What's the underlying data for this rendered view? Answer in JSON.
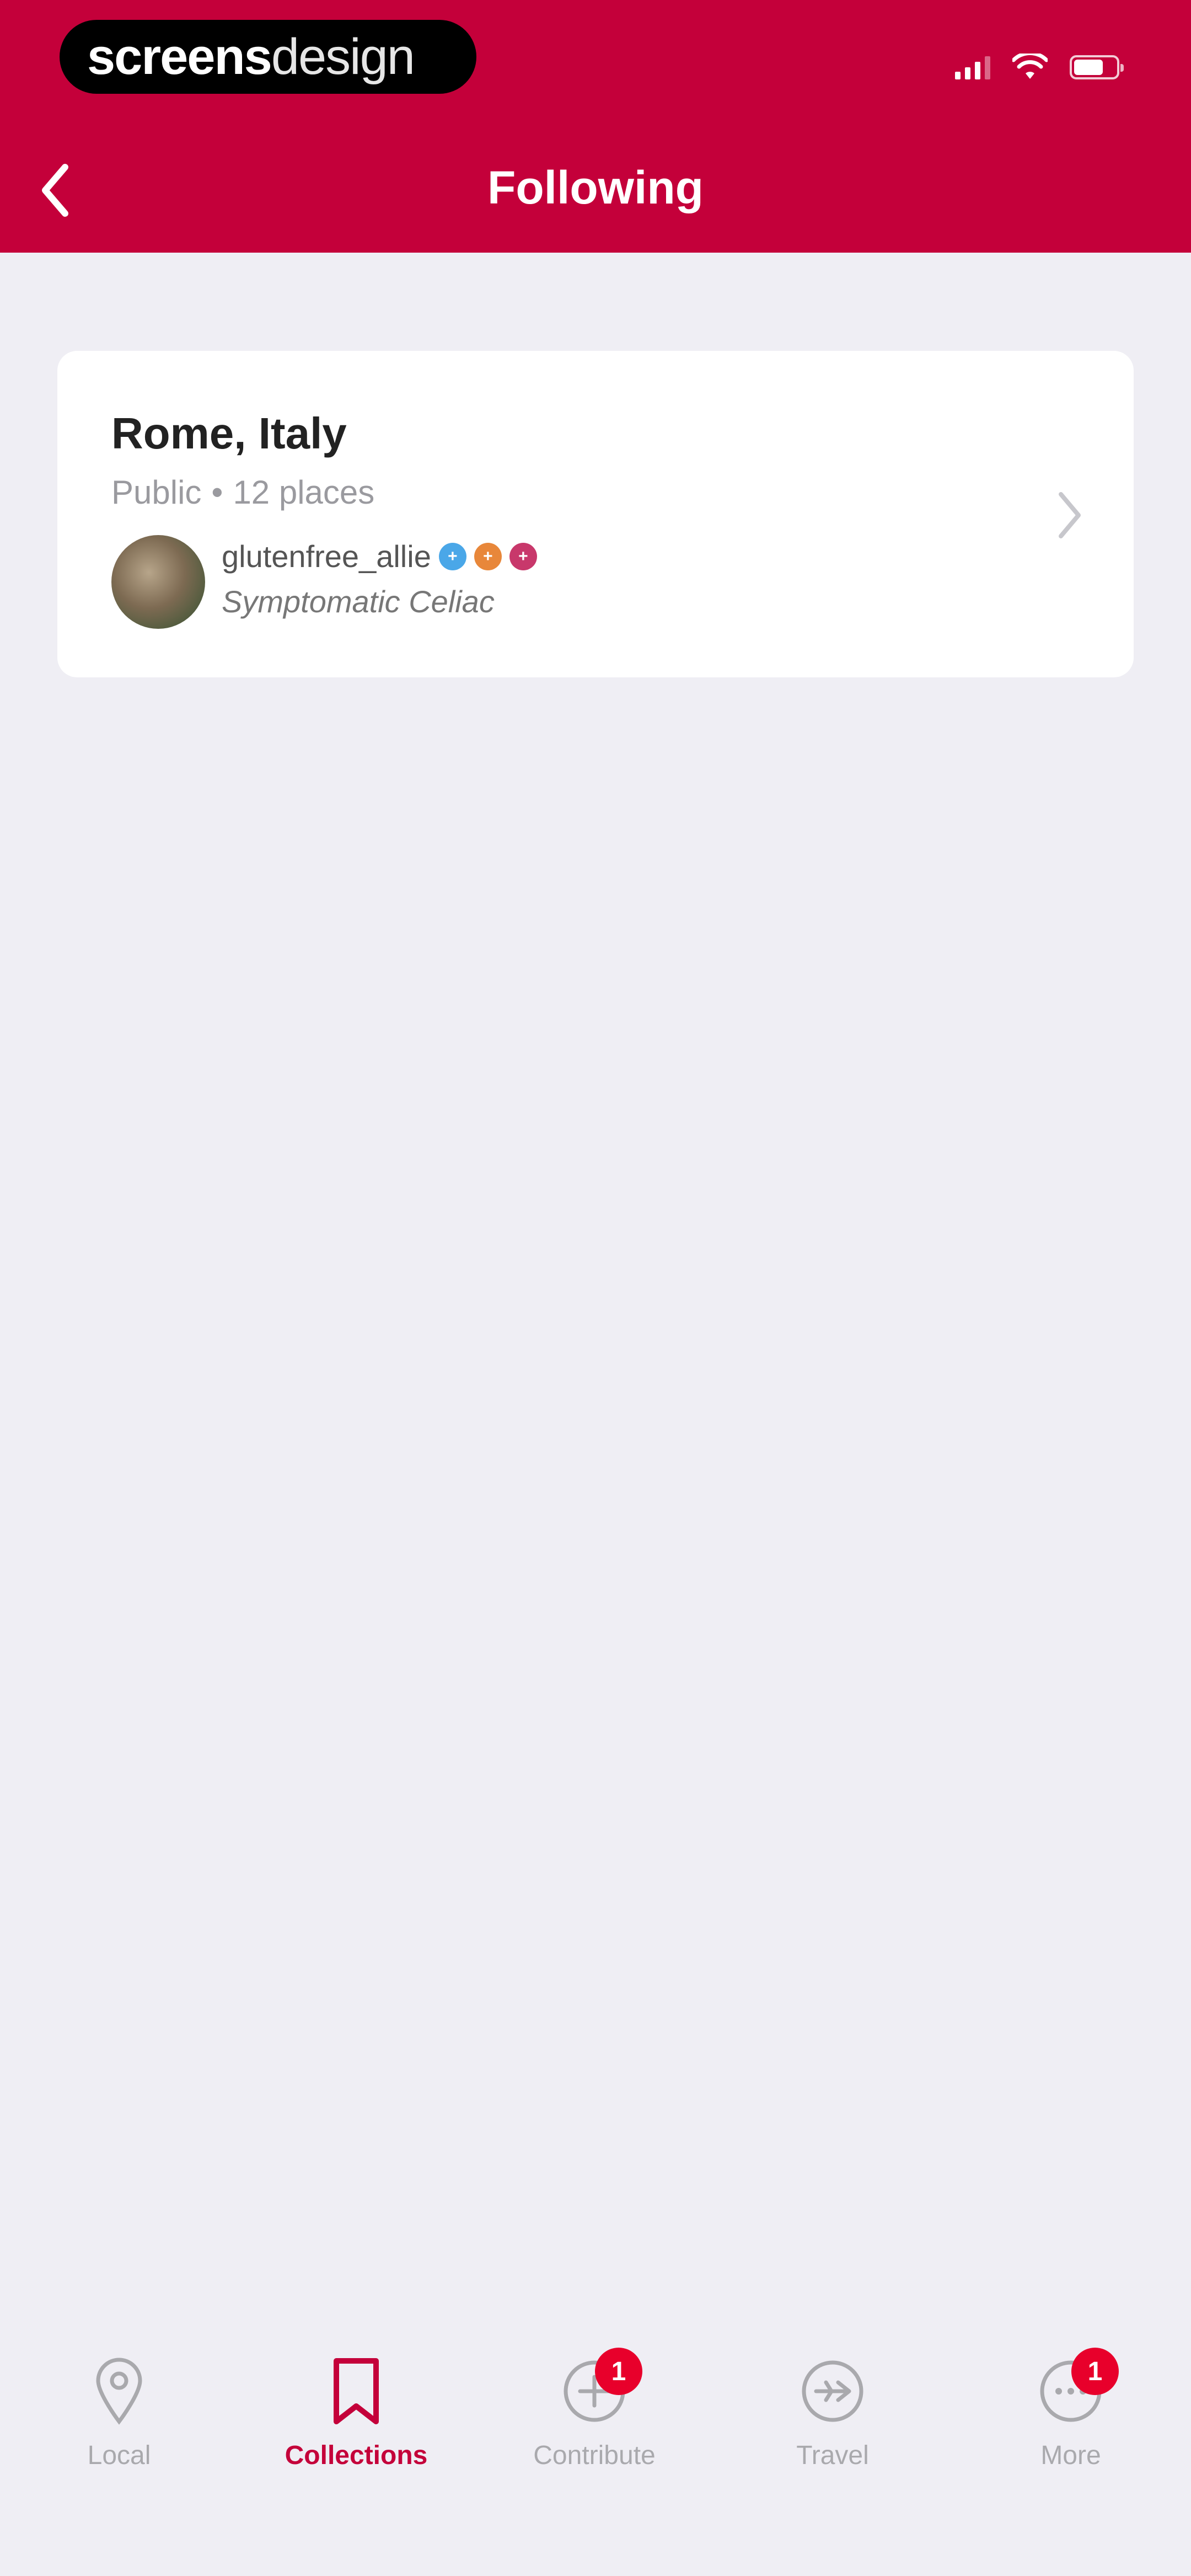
{
  "watermark": {
    "part1": "screens",
    "part2": "design"
  },
  "header": {
    "title": "Following",
    "bg_color": "#c4003a"
  },
  "collection": {
    "title": "Rome, Italy",
    "visibility": "Public",
    "separator": "•",
    "count": "12 places",
    "user": {
      "name": "glutenfree_allie",
      "subtitle": "Symptomatic Celiac",
      "badges": [
        {
          "color": "#4aa7e8",
          "symbol": "+"
        },
        {
          "color": "#e8873a",
          "symbol": "+"
        },
        {
          "color": "#c8386b",
          "symbol": "+"
        }
      ]
    }
  },
  "tabs": [
    {
      "label": "Local",
      "icon": "location-pin-icon",
      "active": false
    },
    {
      "label": "Collections",
      "icon": "bookmark-icon",
      "active": true
    },
    {
      "label": "Contribute",
      "icon": "plus-circle-icon",
      "active": false,
      "badge": "1"
    },
    {
      "label": "Travel",
      "icon": "plane-circle-icon",
      "active": false
    },
    {
      "label": "More",
      "icon": "more-circle-icon",
      "active": false,
      "badge": "1"
    }
  ]
}
